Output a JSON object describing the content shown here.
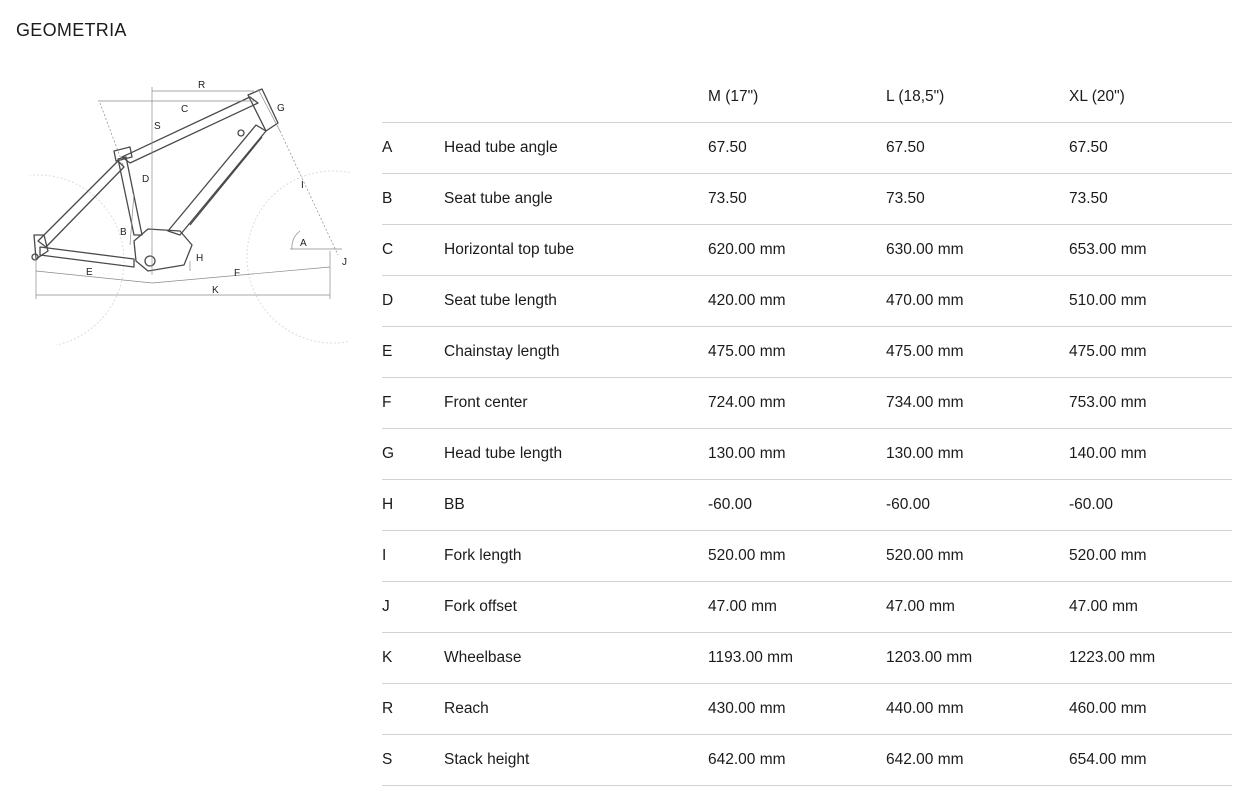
{
  "page": {
    "title": "GEOMETRIA"
  },
  "diagram": {
    "labels": [
      "R",
      "G",
      "C",
      "S",
      "I",
      "D",
      "B",
      "A",
      "H",
      "J",
      "E",
      "F",
      "K"
    ]
  },
  "table": {
    "headers": [
      "",
      "",
      "M (17\")",
      "L (18,5\")",
      "XL (20\")"
    ],
    "rows": [
      {
        "code": "A",
        "name": "Head tube angle",
        "m": "67.50",
        "l": "67.50",
        "xl": "67.50"
      },
      {
        "code": "B",
        "name": "Seat tube angle",
        "m": "73.50",
        "l": "73.50",
        "xl": "73.50"
      },
      {
        "code": "C",
        "name": "Horizontal top tube",
        "m": "620.00 mm",
        "l": "630.00 mm",
        "xl": "653.00 mm"
      },
      {
        "code": "D",
        "name": "Seat tube length",
        "m": "420.00 mm",
        "l": "470.00 mm",
        "xl": "510.00 mm"
      },
      {
        "code": "E",
        "name": "Chainstay length",
        "m": "475.00 mm",
        "l": "475.00 mm",
        "xl": "475.00 mm"
      },
      {
        "code": "F",
        "name": "Front center",
        "m": "724.00 mm",
        "l": "734.00 mm",
        "xl": "753.00 mm"
      },
      {
        "code": "G",
        "name": "Head tube length",
        "m": "130.00 mm",
        "l": "130.00 mm",
        "xl": "140.00 mm"
      },
      {
        "code": "H",
        "name": "BB",
        "m": "-60.00",
        "l": "-60.00",
        "xl": "-60.00"
      },
      {
        "code": "I",
        "name": "Fork length",
        "m": "520.00 mm",
        "l": "520.00 mm",
        "xl": "520.00 mm"
      },
      {
        "code": "J",
        "name": "Fork offset",
        "m": "47.00 mm",
        "l": "47.00 mm",
        "xl": "47.00 mm"
      },
      {
        "code": "K",
        "name": "Wheelbase",
        "m": "1193.00 mm",
        "l": "1203.00 mm",
        "xl": "1223.00 mm"
      },
      {
        "code": "R",
        "name": "Reach",
        "m": "430.00 mm",
        "l": "440.00 mm",
        "xl": "460.00 mm"
      },
      {
        "code": "S",
        "name": "Stack height",
        "m": "642.00 mm",
        "l": "642.00 mm",
        "xl": "654.00 mm"
      }
    ]
  }
}
